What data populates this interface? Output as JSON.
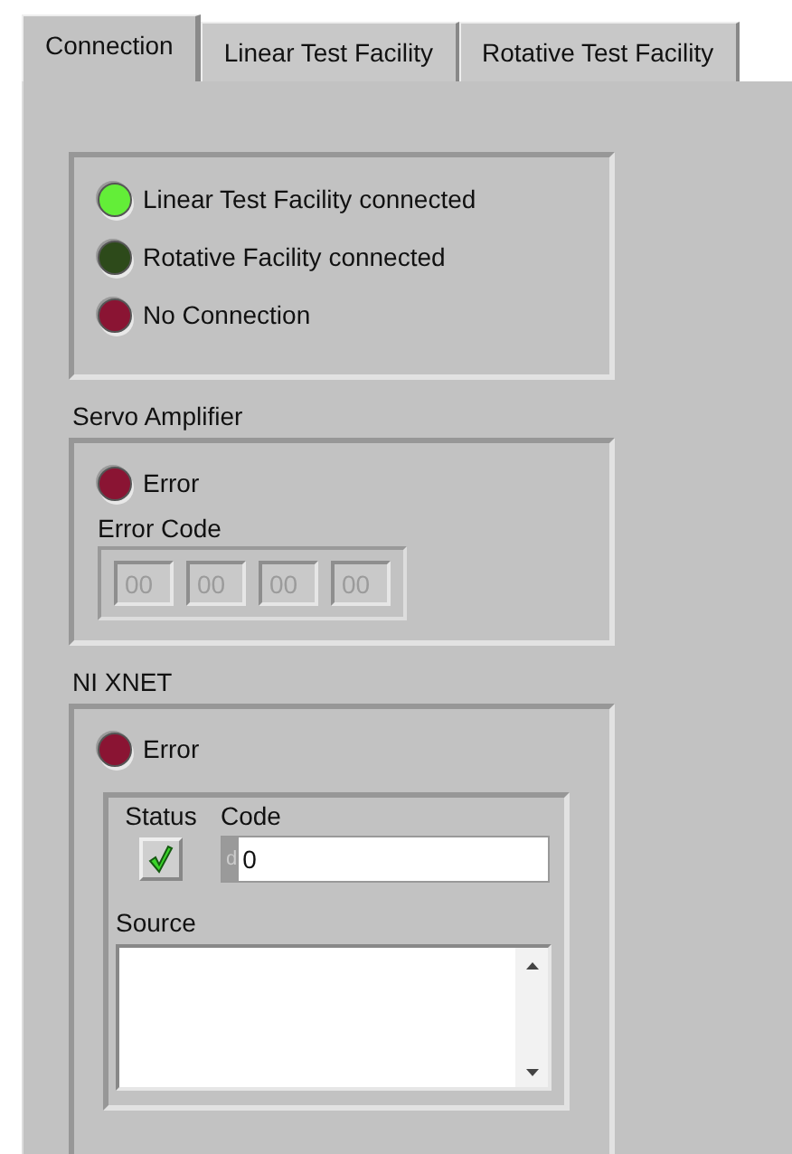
{
  "tabs": [
    {
      "label": "Connection",
      "selected": true
    },
    {
      "label": "Linear Test Facility",
      "selected": false
    },
    {
      "label": "Rotative Test Facility",
      "selected": false
    }
  ],
  "connection_leds": [
    {
      "label": "Linear Test Facility connected",
      "color": "#63ee38"
    },
    {
      "label": "Rotative Facility connected",
      "color": "#2d4a1a"
    },
    {
      "label": "No Connection",
      "color": "#8a1433"
    }
  ],
  "servo_amplifier": {
    "title": "Servo Amplifier",
    "error_led": {
      "label": "Error",
      "color": "#8a1433"
    },
    "error_code": {
      "label": "Error Code",
      "fields": [
        {
          "value": "00",
          "disabled": true
        },
        {
          "value": "00",
          "disabled": true
        },
        {
          "value": "00",
          "disabled": true
        },
        {
          "value": "00",
          "disabled": true
        }
      ]
    }
  },
  "ni_xnet": {
    "title": "NI XNET",
    "error_led": {
      "label": "Error",
      "color": "#8a1433"
    },
    "status": {
      "label": "Status",
      "checked": true
    },
    "code": {
      "label": "Code",
      "radix": "d",
      "value": "0"
    },
    "source": {
      "label": "Source"
    }
  }
}
